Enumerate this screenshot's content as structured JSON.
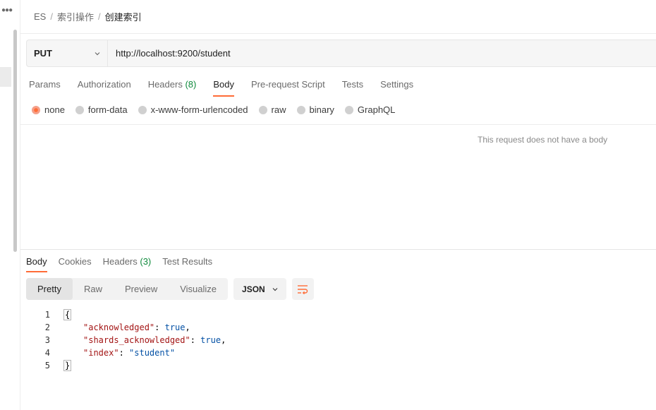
{
  "breadcrumb": {
    "items": [
      "ES",
      "索引操作",
      "创建索引"
    ],
    "separator": "/"
  },
  "request": {
    "method": "PUT",
    "url": "http://localhost:9200/student",
    "tabs": [
      {
        "label": "Params"
      },
      {
        "label": "Authorization"
      },
      {
        "label": "Headers",
        "count": "(8)"
      },
      {
        "label": "Body",
        "active": true
      },
      {
        "label": "Pre-request Script"
      },
      {
        "label": "Tests"
      },
      {
        "label": "Settings"
      }
    ],
    "body_types": [
      "none",
      "form-data",
      "x-www-form-urlencoded",
      "raw",
      "binary",
      "GraphQL"
    ],
    "selected_body_type": "none",
    "no_body_message": "This request does not have a body"
  },
  "response": {
    "tabs": [
      {
        "label": "Body",
        "active": true
      },
      {
        "label": "Cookies"
      },
      {
        "label": "Headers",
        "count": "(3)"
      },
      {
        "label": "Test Results"
      }
    ],
    "view_modes": [
      "Pretty",
      "Raw",
      "Preview",
      "Visualize"
    ],
    "active_view": "Pretty",
    "format": "JSON",
    "code": {
      "line_numbers": [
        "1",
        "2",
        "3",
        "4",
        "5"
      ],
      "open_brace": "{",
      "close_brace": "}",
      "entries": [
        {
          "key": "\"acknowledged\"",
          "value": "true",
          "suffix": ","
        },
        {
          "key": "\"shards_acknowledged\"",
          "value": "true",
          "suffix": ","
        },
        {
          "key": "\"index\"",
          "value": "\"student\"",
          "suffix": ""
        }
      ]
    }
  },
  "colors": {
    "accent": "#ff6c37",
    "count_green": "#0f8a3c",
    "json_key": "#a31515",
    "json_value": "#0451a5"
  },
  "icons": {
    "method_dropdown": "chevron-down-icon",
    "format_dropdown": "chevron-down-icon",
    "wrap": "wrap-lines-icon",
    "more": "more-dots-icon"
  }
}
